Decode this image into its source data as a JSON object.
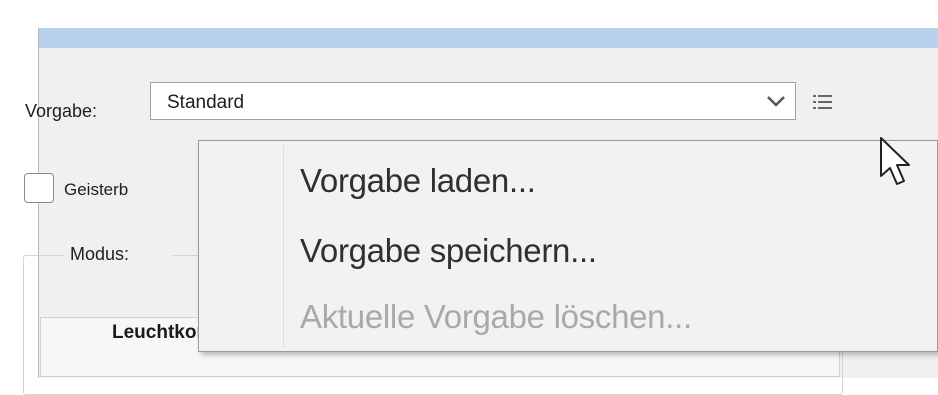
{
  "preset": {
    "label": "Vorgabe:",
    "value": "Standard"
  },
  "ghost_checkbox": {
    "label": "Geisterb",
    "checked": false
  },
  "mode_group": {
    "label": "Modus:",
    "selected_item": "Leuchtkonturen"
  },
  "context_menu": {
    "items": [
      {
        "label": "Vorgabe laden...",
        "enabled": true
      },
      {
        "label": "Vorgabe speichern...",
        "enabled": true
      },
      {
        "label": "Aktuelle Vorgabe löschen...",
        "enabled": false
      }
    ]
  },
  "colors": {
    "titlebar": "#b9d1ea",
    "window_bg": "#f0f0f0",
    "menu_bg": "#f2f2f2",
    "disabled_text": "#a9a9a9"
  },
  "icons": {
    "preset_dropdown": "chevron-down-icon",
    "preset_menu": "list-menu-icon",
    "pointer": "mouse-pointer-icon"
  }
}
